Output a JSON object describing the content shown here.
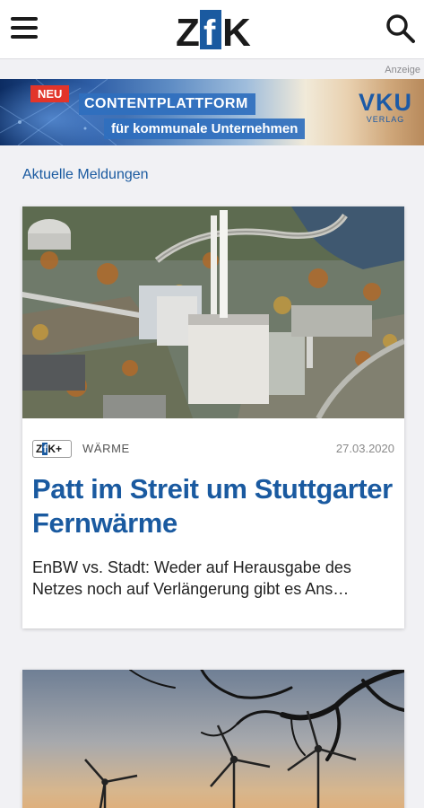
{
  "header": {
    "logo_left": "Z",
    "logo_mid": "f",
    "logo_right": "K"
  },
  "ad": {
    "anzeige_label": "Anzeige",
    "badge": "NEU",
    "line1": "CONTENTPLATTFORM",
    "line2": "für kommunale Unternehmen",
    "brand": "VKU",
    "brand_sub": "VERLAG"
  },
  "feed": {
    "section_title": "Aktuelle Meldungen",
    "articles": [
      {
        "badge": "ZfK+",
        "badge_z": "Z",
        "badge_f": "f",
        "badge_rest": "K+",
        "category": "WÄRME",
        "date": "27.03.2020",
        "title": "Patt im Streit um Stuttgarter Fernwärme",
        "teaser": "EnBW vs. Stadt: Weder auf Herausgabe des Netzes noch auf Verlängerung gibt es Ans…"
      }
    ]
  },
  "colors": {
    "accent": "#1a5aa0",
    "ad_red": "#e2352a",
    "background": "#f1f1f4"
  },
  "icons": {
    "menu": "hamburger-menu-icon",
    "search": "search-icon"
  }
}
